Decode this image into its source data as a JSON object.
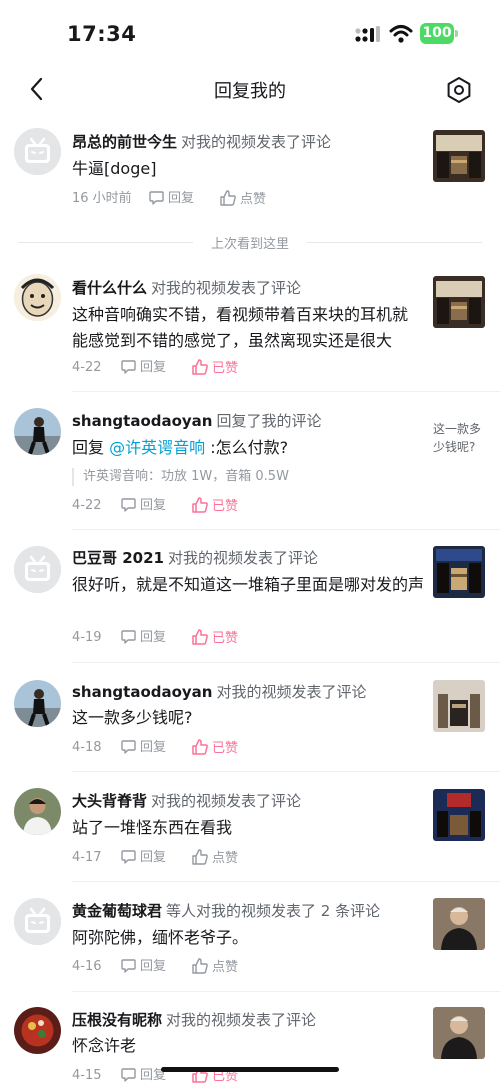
{
  "status_bar": {
    "time": "17:34",
    "battery": "100"
  },
  "nav": {
    "title": "回复我的"
  },
  "divider": {
    "text": "上次看到这里"
  },
  "reply_label": "回复",
  "like_label": "点赞",
  "liked_label": "已赞",
  "items": [
    {
      "name": "昂总的前世今生",
      "action": "对我的视频发表了评论",
      "content": "牛逼[doge]",
      "date": "16 小时前",
      "liked": false
    },
    {
      "name": "看什么什么",
      "action": "对我的视频发表了评论",
      "content": "这种音响确实不错，看视频带着百来块的耳机就能感觉到不错的感觉了，虽然离现实还是很大",
      "date": "4-22",
      "liked": true
    },
    {
      "name": "shangtaodaoyan",
      "action": "回复了我的评论",
      "content_prefix": "回复 ",
      "mention": "@许英谔音响",
      "content_suffix": " :怎么付款?",
      "quote": "许英谔音响：功放 1W，音箱 0.5W",
      "date": "4-22",
      "liked": true,
      "thumb_text": "这一款多少钱呢?"
    },
    {
      "name": "巴豆哥 2021",
      "action": "对我的视频发表了评论",
      "content": "很好听，就是不知道这一堆箱子里面是哪对发的声",
      "date": "4-19",
      "liked": true
    },
    {
      "name": "shangtaodaoyan",
      "action": "对我的视频发表了评论",
      "content": "这一款多少钱呢?",
      "date": "4-18",
      "liked": true
    },
    {
      "name": "大头背脊背",
      "action": "对我的视频发表了评论",
      "content": "站了一堆怪东西在看我",
      "date": "4-17",
      "liked": false
    },
    {
      "name": "黄金葡萄球君",
      "action": "等人对我的视频发表了 2 条评论",
      "content": "阿弥陀佛，缅怀老爷子。",
      "date": "4-16",
      "liked": false
    },
    {
      "name": "压根没有昵称",
      "action": "对我的视频发表了评论",
      "content": "怀念许老",
      "date": "4-15",
      "liked": true
    }
  ],
  "colors": {
    "accent_pink": "#fb7299",
    "link_blue": "#00a1d6",
    "gray_text": "#9499a0"
  }
}
